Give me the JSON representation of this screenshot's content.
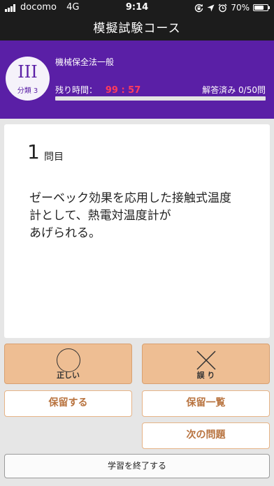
{
  "status_bar": {
    "carrier": "docomo",
    "network": "4G",
    "time": "9:14",
    "battery_percent": "70%",
    "battery_level": 0.7
  },
  "nav": {
    "title": "模擬試験コース"
  },
  "header": {
    "badge_numeral": "III",
    "badge_label": "分類 3",
    "subject": "機械保全法一般",
    "time_label": "残り時間：",
    "time_value": "99 : 57",
    "answered": "解答済み 0/50問",
    "progress_fraction": 0.0
  },
  "question": {
    "number": "1",
    "number_label": "問目",
    "text": "ゼーベック効果を応用した接触式温度\n計として、熱電対温度計が\nあげられる。"
  },
  "buttons": {
    "correct_label": "正しい",
    "wrong_label": "誤 り",
    "hold_label": "保留する",
    "hold_list_label": "保留一覧",
    "next_label": "次の問題",
    "finish_label": "学習を終了する"
  },
  "colors": {
    "header_purple": "#5a1fa6",
    "answer_button": "#eebe93",
    "outline_button_text": "#b8733f",
    "timer_red": "#ff3b5c"
  },
  "icons": {
    "correct": "circle-icon",
    "wrong": "cross-icon",
    "status": [
      "signal-bars-icon",
      "lock-rotation-icon",
      "location-arrow-icon",
      "alarm-icon",
      "battery-icon"
    ]
  }
}
